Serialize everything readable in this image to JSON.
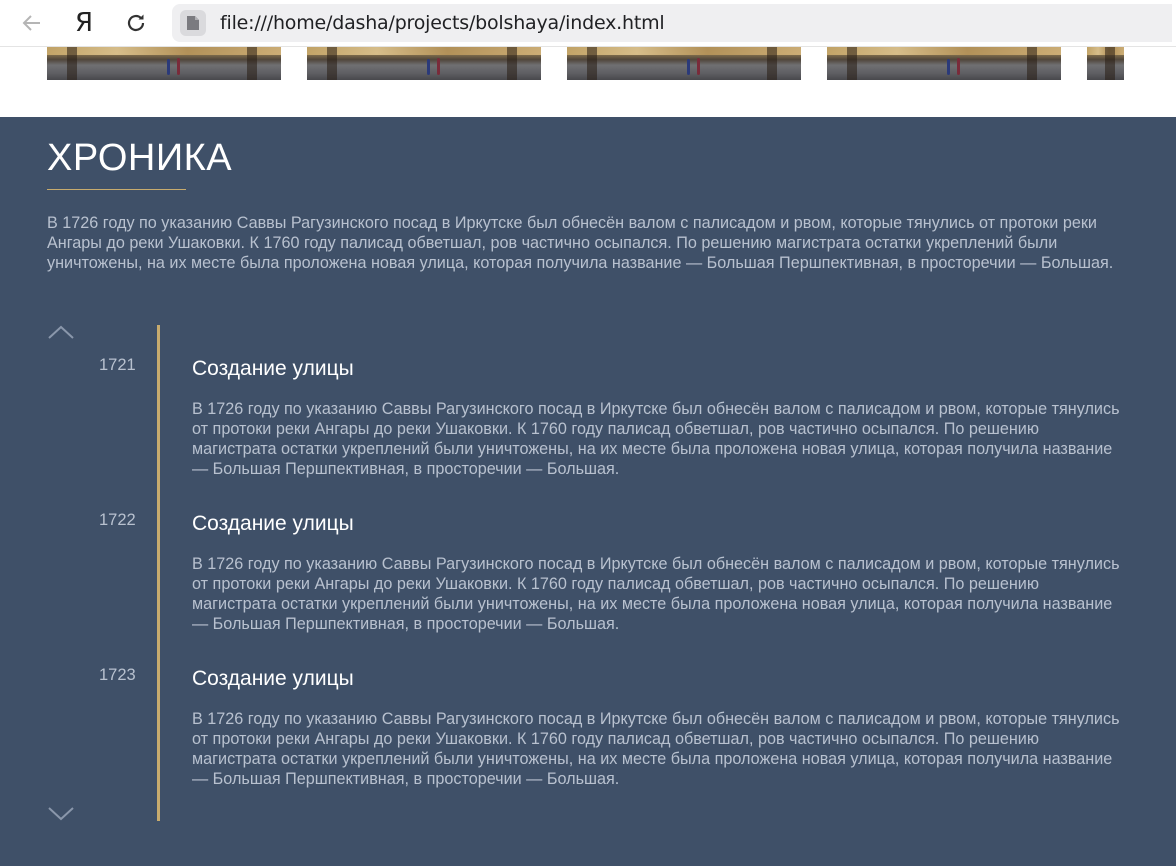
{
  "browser": {
    "url": "file:///home/dasha/projects/bolshaya/index.html",
    "logo_letter": "Я"
  },
  "chronicle": {
    "title": "ХРОНИКА",
    "intro": "В 1726 году по указанию Саввы Рагузинского посад в Иркутске был обнесён валом с палисадом и рвом, которые тянулись от протоки реки Ангары до реки Ушаковки. К 1760 году палисад обветшал, ров частично осыпался. По решению магистрата остатки укреплений были уничтожены, на их месте была проложена новая улица, которая получила название — Большая Першпективная, в просторечии — Большая.",
    "events": [
      {
        "year": "1721",
        "title": "Создание улицы",
        "text": "В 1726 году по указанию Саввы Рагузинского посад в Иркутске был обнесён валом с палисадом и рвом, которые тянулись от протоки реки Ангары до реки Ушаковки. К 1760 году палисад обветшал, ров частично осыпался. По решению магистрата остатки укреплений были уничтожены, на их месте была проложена новая улица, которая получила название — Большая Першпективная, в просторечии — Большая."
      },
      {
        "year": "1722",
        "title": "Создание улицы",
        "text": "В 1726 году по указанию Саввы Рагузинского посад в Иркутске был обнесён валом с палисадом и рвом, которые тянулись от протоки реки Ангары до реки Ушаковки. К 1760 году палисад обветшал, ров частично осыпался. По решению магистрата остатки укреплений были уничтожены, на их месте была проложена новая улица, которая получила название — Большая Першпективная, в просторечии — Большая."
      },
      {
        "year": "1723",
        "title": "Создание улицы",
        "text": "В 1726 году по указанию Саввы Рагузинского посад в Иркутске был обнесён валом с палисадом и рвом, которые тянулись от протоки реки Ангары до реки Ушаковки. К 1760 году палисад обветшал, ров частично осыпался. По решению магистрата остатки укреплений были уничтожены, на их месте была проложена новая улица, которая получила название — Большая Першпективная, в просторечии — Большая."
      }
    ]
  },
  "colors": {
    "section_bg": "#3f5068",
    "accent_gold": "#c7ab6e",
    "text_muted": "#b8c1cf",
    "heading": "#ffffff"
  },
  "icons": [
    "back-arrow-icon",
    "reload-icon",
    "page-icon",
    "chevron-up-icon",
    "chevron-down-icon"
  ]
}
